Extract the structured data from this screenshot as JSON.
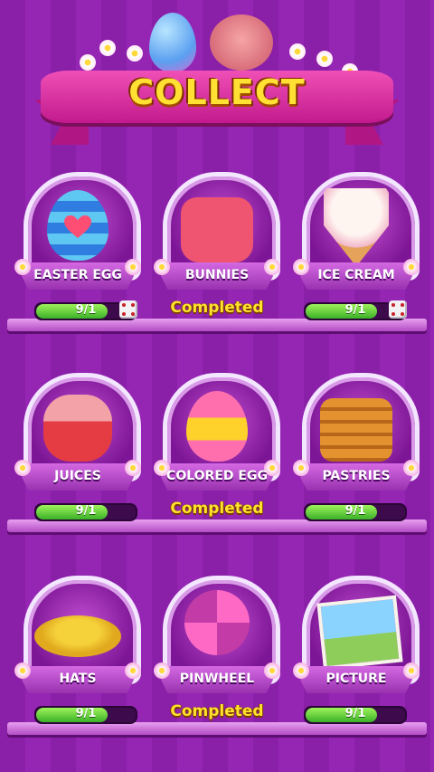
{
  "header": {
    "title": "COLLECT"
  },
  "items": [
    {
      "label": "EASTER EGG",
      "status": "progress",
      "progress_text": "9/1",
      "art": "easter-egg-art",
      "has_dice": true
    },
    {
      "label": "BUNNIES",
      "status": "completed",
      "completed_text": "Completed",
      "art": "bunny-art"
    },
    {
      "label": "ICE CREAM",
      "status": "progress",
      "progress_text": "9/1",
      "art": "ice-cream-art",
      "has_dice": true
    },
    {
      "label": "JUICES",
      "status": "progress",
      "progress_text": "9/1",
      "art": "juice-jar-art",
      "has_dice": false
    },
    {
      "label": "COLORED EGG",
      "status": "completed",
      "completed_text": "Completed",
      "art": "colored-egg-art"
    },
    {
      "label": "PASTRIES",
      "status": "progress",
      "progress_text": "9/1",
      "art": "pastries-art",
      "has_dice": false
    },
    {
      "label": "HATS",
      "status": "progress",
      "progress_text": "9/1",
      "art": "hat-art",
      "has_dice": false
    },
    {
      "label": "PINWHEEL",
      "status": "completed",
      "completed_text": "Completed",
      "art": "pinwheel-art"
    },
    {
      "label": "PICTURE",
      "status": "progress",
      "progress_text": "9/1",
      "art": "picture-art",
      "has_dice": false
    }
  ],
  "colors": {
    "background": "#8a1fa8",
    "title_yellow": "#ffe033",
    "completed_yellow": "#ffe22e",
    "progress_green": "#3bb128"
  }
}
